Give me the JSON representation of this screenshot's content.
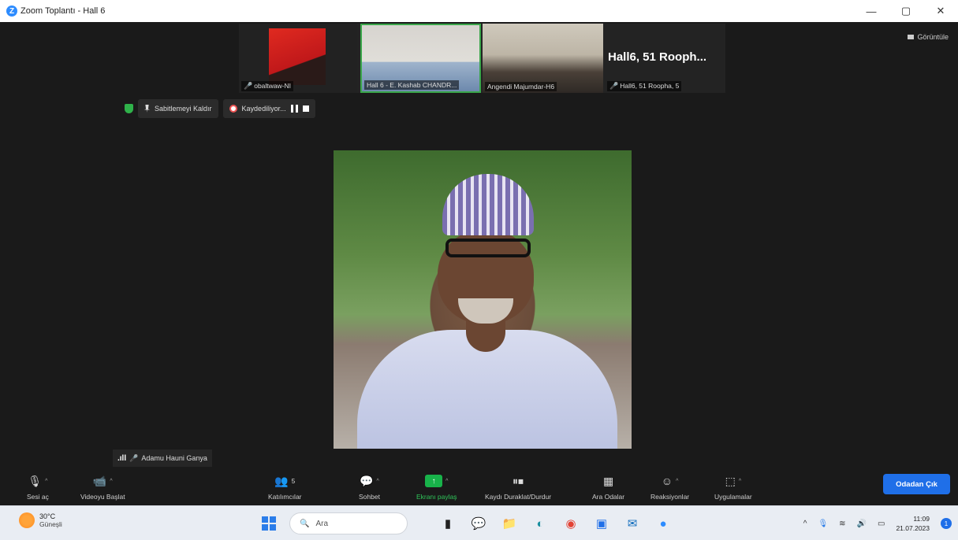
{
  "window": {
    "title": "Zoom Toplantı - Hall 6",
    "app_icon": "zoom-icon",
    "controls": {
      "minimize": "—",
      "maximize": "▢",
      "close": "✕"
    }
  },
  "view_button": {
    "label": "Görüntüle"
  },
  "thumbnails": [
    {
      "label": "obaltwaw-NI",
      "muted": true
    },
    {
      "label": "Hall 6 - E. Kashab CHANDR...",
      "muted": false,
      "active_speaker": true
    },
    {
      "label": "Angendi Majumdar-H6",
      "muted": false
    },
    {
      "label": "Hall6, 51 Roopha, 5",
      "muted": true,
      "display_name": "Hall6, 51 Rooph..."
    }
  ],
  "meeting_bar": {
    "pinned_label": "Sabitlemeyi Kaldır",
    "recording_label": "Kaydediliyor..."
  },
  "speaker": {
    "name": "Adamu Hauni Ganya"
  },
  "toolbar": {
    "audio": "Sesi aç",
    "video": "Videoyu Başlat",
    "participants": "Katılımcılar",
    "participants_count": "5",
    "chat": "Sohbet",
    "share": "Ekranı paylaş",
    "record": "Kaydı Duraklat/Durdur",
    "breakout": "Ara Odalar",
    "reactions": "Reaksiyonlar",
    "apps": "Uygulamalar",
    "leave": "Odadan Çık"
  },
  "taskbar": {
    "weather_temp": "30°C",
    "weather_desc": "Güneşli",
    "search_placeholder": "Ara",
    "time": "11:09",
    "date": "21.07.2023",
    "notification_count": "1"
  }
}
